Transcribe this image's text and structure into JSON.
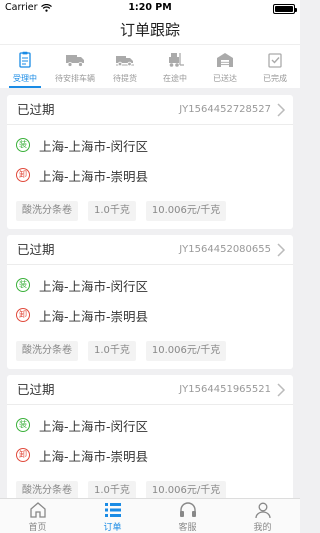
{
  "status_bar": {
    "carrier": "Carrier",
    "time": "1:20 PM"
  },
  "nav": {
    "title": "订单跟踪"
  },
  "status_tabs": [
    {
      "label": "受理中",
      "icon": "clipboard-icon",
      "active": true
    },
    {
      "label": "待安排车辆",
      "icon": "truck-icon",
      "active": false
    },
    {
      "label": "待提货",
      "icon": "delivery-truck-icon",
      "active": false
    },
    {
      "label": "在途中",
      "icon": "forklift-icon",
      "active": false
    },
    {
      "label": "已送达",
      "icon": "warehouse-icon",
      "active": false
    },
    {
      "label": "已完成",
      "icon": "handshake-icon",
      "active": false
    }
  ],
  "orders": [
    {
      "status": "已过期",
      "order_no": "JY1564452728527",
      "load_badge": "装",
      "load_address": "上海-上海市-闵行区",
      "unload_badge": "卸",
      "unload_address": "上海-上海市-崇明县",
      "tags": [
        "酸洗分条卷",
        "1.0千克",
        "10.006元/千克"
      ]
    },
    {
      "status": "已过期",
      "order_no": "JY1564452080655",
      "load_badge": "装",
      "load_address": "上海-上海市-闵行区",
      "unload_badge": "卸",
      "unload_address": "上海-上海市-崇明县",
      "tags": [
        "酸洗分条卷",
        "1.0千克",
        "10.006元/千克"
      ]
    },
    {
      "status": "已过期",
      "order_no": "JY1564451965521",
      "load_badge": "装",
      "load_address": "上海-上海市-闵行区",
      "unload_badge": "卸",
      "unload_address": "上海-上海市-崇明县",
      "tags": [
        "酸洗分条卷",
        "1.0千克",
        "10.006元/千克"
      ]
    }
  ],
  "tab_bar": [
    {
      "label": "首页",
      "icon": "home-icon",
      "active": false
    },
    {
      "label": "订单",
      "icon": "list-icon",
      "active": true
    },
    {
      "label": "客服",
      "icon": "headset-icon",
      "active": false
    },
    {
      "label": "我的",
      "icon": "person-icon",
      "active": false
    }
  ],
  "colors": {
    "accent": "#1a8be5",
    "load": "#3bb13b",
    "unload": "#e14a3c"
  }
}
